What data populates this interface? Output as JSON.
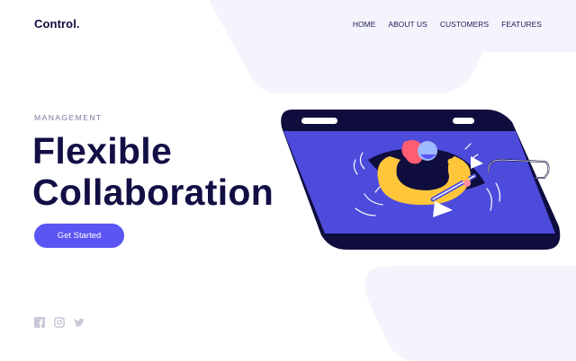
{
  "brand": {
    "logo_text": "Control."
  },
  "nav": {
    "items": [
      {
        "label": "HOME"
      },
      {
        "label": "ABOUT US"
      },
      {
        "label": "CUSTOMERS"
      },
      {
        "label": "FEATURES"
      }
    ]
  },
  "hero": {
    "eyebrow": "MANAGEMENT",
    "headline_line1": "Flexible",
    "headline_line2": "Collaboration",
    "cta_label": "Get Started"
  },
  "social": {
    "icons": [
      "facebook-icon",
      "instagram-icon",
      "twitter-icon"
    ]
  },
  "colors": {
    "accent": "#5a55f3",
    "navy": "#120f45",
    "background_shape": "#f4f4fd",
    "illustration_blue": "#4d4bdc",
    "illustration_yellow": "#ffc63b"
  }
}
